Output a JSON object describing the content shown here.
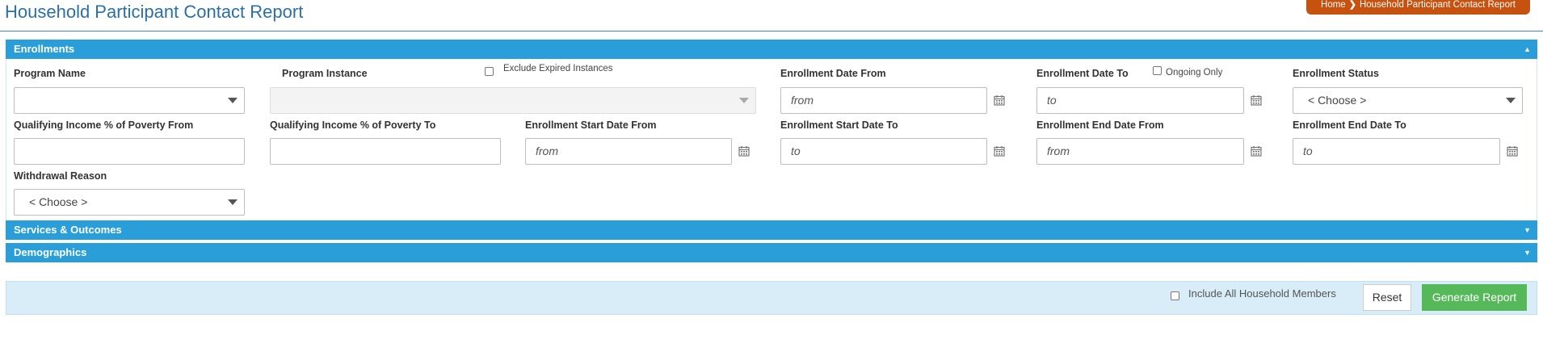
{
  "page": {
    "title": "Household Participant Contact Report"
  },
  "breadcrumb": {
    "home": "Home",
    "current": "Household Participant Contact Report"
  },
  "sections": {
    "enrollments": "Enrollments",
    "services": "Services & Outcomes",
    "demographics": "Demographics"
  },
  "fields": {
    "program_name": {
      "label": "Program Name",
      "value": ""
    },
    "program_instance": {
      "label": "Program Instance",
      "value": ""
    },
    "exclude_expired": {
      "label": "Exclude Expired Instances",
      "checked": false
    },
    "enroll_date_from": {
      "label": "Enrollment Date From",
      "placeholder": "from"
    },
    "enroll_date_to": {
      "label": "Enrollment Date To",
      "placeholder": "to"
    },
    "ongoing_only": {
      "label": "Ongoing Only",
      "checked": false
    },
    "enroll_status": {
      "label": "Enrollment Status",
      "value": "< Choose >"
    },
    "income_from": {
      "label": "Qualifying Income % of Poverty From",
      "value": ""
    },
    "income_to": {
      "label": "Qualifying Income % of Poverty To",
      "value": ""
    },
    "start_from": {
      "label": "Enrollment Start Date From",
      "placeholder": "from"
    },
    "start_to": {
      "label": "Enrollment Start Date To",
      "placeholder": "to"
    },
    "end_from": {
      "label": "Enrollment End Date From",
      "placeholder": "from"
    },
    "end_to": {
      "label": "Enrollment End Date To",
      "placeholder": "to"
    },
    "withdrawal": {
      "label": "Withdrawal Reason",
      "value": "< Choose >"
    }
  },
  "footer": {
    "include_household": {
      "label": "Include All Household Members",
      "checked": false
    },
    "reset_label": "Reset",
    "generate_label": "Generate Report"
  },
  "colors": {
    "panel": "#2a9ed8",
    "breadcrumb": "#c7510f",
    "generate_button": "#55b95a"
  },
  "icons": {
    "calendar": "calendar-icon",
    "dropdown": "chevron-down-icon"
  }
}
